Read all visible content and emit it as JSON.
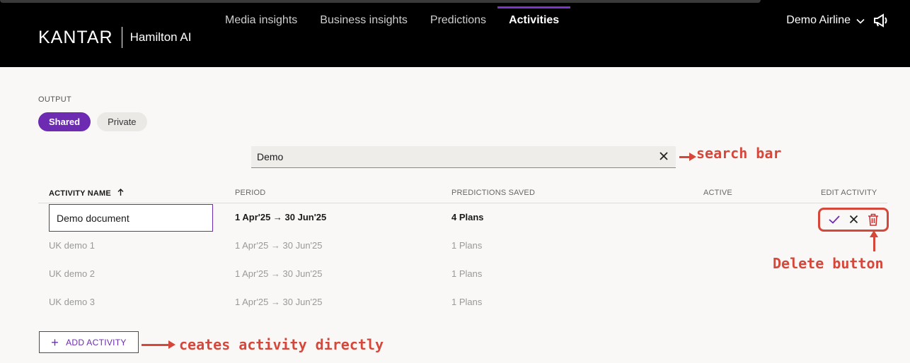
{
  "header": {
    "logo_brand": "KANTAR",
    "logo_product": "Hamilton AI",
    "nav": [
      {
        "label": "Media insights"
      },
      {
        "label": "Business insights"
      },
      {
        "label": "Predictions"
      },
      {
        "label": "Activities",
        "active": true
      }
    ],
    "account": "Demo Airline",
    "account_icon": "chevron-down-icon",
    "announce_icon": "megaphone-icon"
  },
  "output": {
    "label": "OUTPUT",
    "options": [
      "Shared",
      "Private"
    ],
    "selected": "Shared"
  },
  "search": {
    "value": "Demo",
    "clear_icon": "close-icon"
  },
  "table": {
    "columns": [
      "ACTIVITY NAME",
      "PERIOD",
      "PREDICTIONS SAVED",
      "ACTIVE",
      "EDIT ACTIVITY"
    ],
    "sort_icon": "arrow-up-icon",
    "rows": [
      {
        "name": "Demo document",
        "period": "1 Apr'25 → 30 Jun'25",
        "predictions": "4 Plans",
        "editing": true
      },
      {
        "name": "UK demo 1",
        "period": "1 Apr'25 → 30 Jun'25",
        "predictions": "1 Plans"
      },
      {
        "name": "UK demo 2",
        "period": "1 Apr'25 → 30 Jun'25",
        "predictions": "1 Plans"
      },
      {
        "name": "UK demo 3",
        "period": "1 Apr'25 → 30 Jun'25",
        "predictions": "1 Plans"
      }
    ],
    "edit_actions": [
      "check-icon",
      "close-icon",
      "trash-icon"
    ]
  },
  "add_activity": {
    "label": "ADD ACTIVITY",
    "icon": "plus-icon"
  },
  "annotations": {
    "search": "search bar",
    "delete": "Delete button",
    "add": "ceates activity directly"
  },
  "colors": {
    "accent": "#6c2bb1",
    "annotation": "#d5473a",
    "header_bg": "#000000",
    "page_bg": "#f9f8f6"
  }
}
